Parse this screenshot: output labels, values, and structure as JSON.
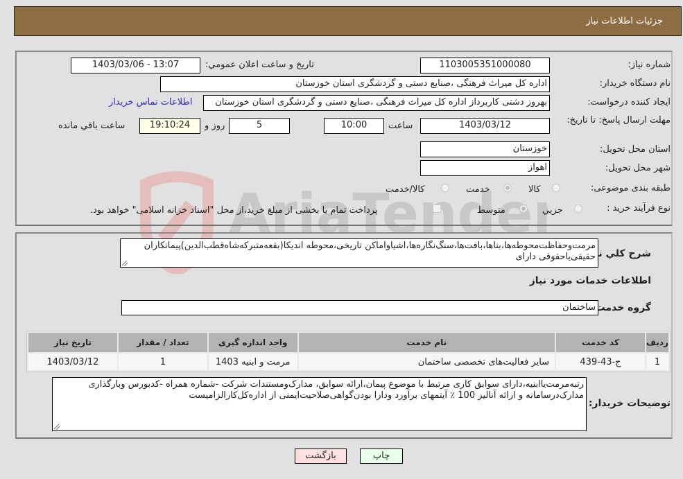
{
  "header": {
    "title": "جزئیات اطلاعات نیاز"
  },
  "form": {
    "need_number_label": "شماره نیاز:",
    "need_number": "1103005351000080",
    "announce_label": "تاریخ و ساعت اعلان عمومي:",
    "announce_value": "1403/03/06 - 13:07",
    "buyer_org_label": "نام دستگاه خریدار:",
    "buyer_org": "اداره کل میراث فرهنگی ،صنایع دستی و گردشگری استان خوزستان",
    "creator_label": "ایجاد کننده درخواست:",
    "creator": "بهروز دشتی کاربرداز اداره کل میراث فرهنگی ،صنایع دستی و گردشگری استان خوزستان",
    "contact_link": "اطلاعات تماس خریدار",
    "deadline_label": "مهلت ارسال پاسخ: تا تاریخ:",
    "deadline_date": "1403/03/12",
    "time_label": "ساعت",
    "deadline_time": "10:00",
    "days_value": "5",
    "days_label": "روز و",
    "remaining_time": "19:10:24",
    "remaining_label": "ساعت باقي مانده",
    "province_label": "استان محل تحویل:",
    "province": "خوزستان",
    "city_label": "شهر محل تحویل:",
    "city": "اهواز",
    "category_label": "طبقه بندی موضوعی:",
    "category_options": [
      {
        "label": "کالا",
        "selected": false
      },
      {
        "label": "خدمت",
        "selected": true
      },
      {
        "label": "کالا/خدمت",
        "selected": false
      }
    ],
    "process_label": "نوع فرآیند خرید :",
    "process_options": [
      {
        "label": "جزيي",
        "selected": false
      },
      {
        "label": "متوسط",
        "selected": true
      }
    ],
    "treasury_note": "پرداخت تمام یا بخشی از مبلغ خرید،از محل \"اسناد خزانه اسلامی\" خواهد بود.",
    "treasury_checked": false
  },
  "description": {
    "label": "شرح کلي نياز:",
    "text": "مرمت‌وحفاظت‌محوطه‌ها،بناها،بافت‌ها،سنگ‌نگاره‌ها،اشیاواماکن تاریخی،محوطه اندیکا(بقعه‌متبرکه‌شاه‌قطب‌الدین)پیمانکاران حقیقی‌یاحقوقی دارای"
  },
  "services": {
    "section_title": "اطلاعات خدمات مورد نیاز",
    "group_label": "گروه خدمت:",
    "group_value": "ساختمان",
    "columns": [
      "ردیف",
      "کد خدمت",
      "نام خدمت",
      "واحد اندازه گیری",
      "تعداد / مقدار",
      "تاریخ نیاز"
    ],
    "rows": [
      [
        "1",
        "ج-43-439",
        "سایر فعالیت‌های تخصصی ساختمان",
        "مرمت و ابنیه 1403",
        "1",
        "1403/03/12"
      ]
    ]
  },
  "buyer_notes": {
    "label": "توضیحات خریدار:",
    "text": "رتبه‌مرمت‌یاابنیه،دارای سوابق کاری مرتبط با موضوع پیمان،ارائه سوابق، مدارک‌ومستندات شرکت -شماره همراه -کدبورس وبارگذاری مدارک‌درسامانه و ارائه آنالیز 100 ٪ آیتمهای برآورد ودارا بودن‌گواهی‌صلاحیت‌ایمنی از اداره‌کل‌کارالزامیست"
  },
  "buttons": {
    "print": "چاپ",
    "back": "بازگشت"
  },
  "watermark": {
    "text": "AriaTender.neT"
  },
  "colors": {
    "header_bg": "#8d6e43",
    "print_bg": "#eaffea",
    "back_bg": "#ffe0e0",
    "link": "#2a2ac0"
  }
}
